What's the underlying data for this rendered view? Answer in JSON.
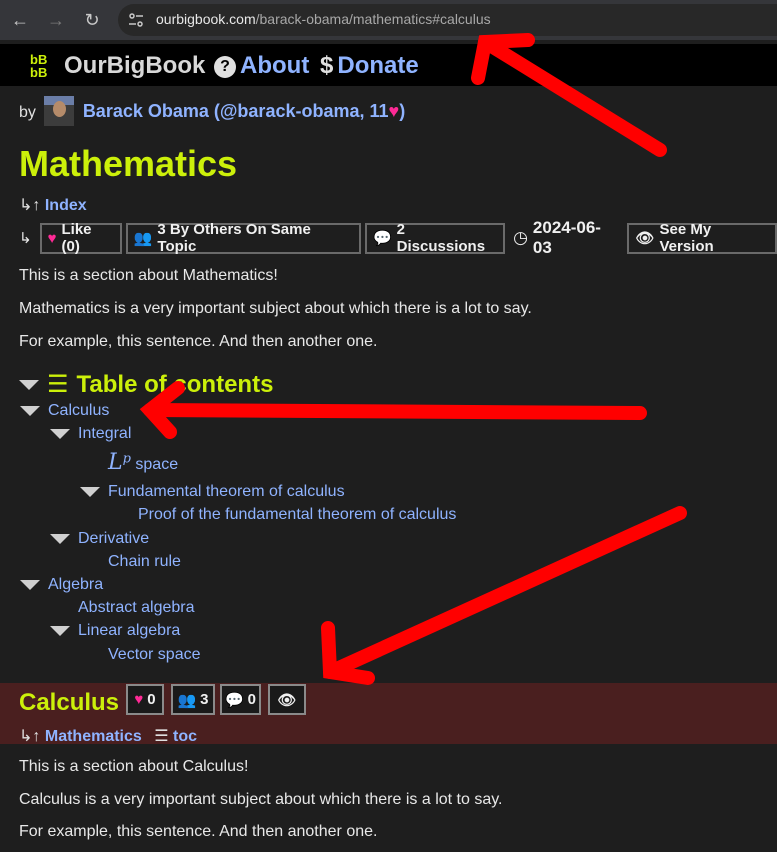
{
  "browser": {
    "url_host": "ourbigbook.com",
    "url_path": "/barack-obama/mathematics#calculus"
  },
  "site": {
    "brand": "OurBigBook",
    "about": "About",
    "donate": "Donate"
  },
  "byline": {
    "by": "by",
    "author": "Barack Obama (@barack-obama, 11",
    "author_end": ")"
  },
  "page": {
    "title": "Mathematics",
    "index_link": "Index",
    "like": "Like (0)",
    "others": "3 By Others On Same Topic",
    "discussions": "2 Discussions",
    "date": "2024-06-03",
    "see_version": "See My Version",
    "paragraphs": [
      "This is a section about Mathematics!",
      "Mathematics is a very important subject about which there is a lot to say.",
      "For example, this sentence. And then another one."
    ]
  },
  "toc": {
    "heading": "Table of contents",
    "items": [
      "Calculus",
      "Integral",
      "space",
      "Fundamental theorem of calculus",
      "Proof of the fundamental theorem of calculus",
      "Derivative",
      "Chain rule",
      "Algebra",
      "Abstract algebra",
      "Linear algebra",
      "Vector space"
    ],
    "lp_base": "L",
    "lp_sup": "p"
  },
  "calculus": {
    "title": "Calculus",
    "likes": "0",
    "others": "3",
    "discussions": "0",
    "parent_link": "Mathematics",
    "toc_link": "toc",
    "paragraphs": [
      "This is a section about Calculus!",
      "Calculus is a very important subject about which there is a lot to say.",
      "For example, this sentence. And then another one."
    ]
  },
  "colors": {
    "title": "#ccf00a",
    "link": "#8fb3ff",
    "heart": "#ff2a96",
    "arrow": "#ff0000",
    "band": "#4a1f1f"
  }
}
